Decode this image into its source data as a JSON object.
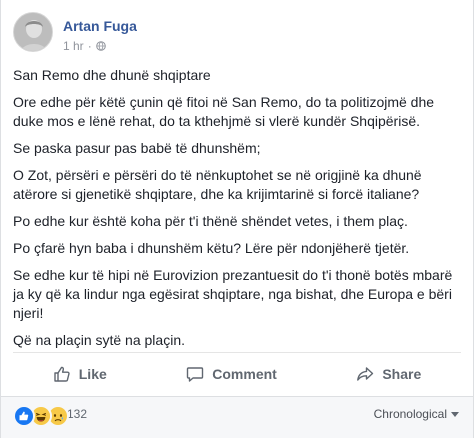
{
  "post": {
    "author": "Artan Fuga",
    "time": "1 hr",
    "separator": "·",
    "paragraphs": [
      "San Remo dhe dhunë shqiptare",
      "Ore edhe për këtë çunin që fitoi në San Remo, do ta politizojmë dhe duke mos e lënë rehat, do ta kthehjmë si vlerë kundër Shqipërisë.",
      "Se paska pasur pas babë të dhunshëm;",
      "O Zot, përsëri e përsëri do të nënkuptohet se në origjinë ka dhunë atërore si gjenetikë shqiptare, dhe ka krijimtarinë si forcë italiane?",
      "Po edhe kur është koha për t'i thënë shëndet vetes, i them plaç.",
      "Po çfarë hyn baba i dhunshëm këtu? Lëre për ndonjëherë tjetër.",
      "Se edhe kur të hipi në Eurovizion prezantuesit do t'i thonë botës mbarë ja ky që ka lindur nga egësirat shqiptare, nga bishat, dhe Europa e bëri njeri!",
      "Që na plaçin sytë na plaçin."
    ]
  },
  "actions": {
    "like": "Like",
    "comment": "Comment",
    "share": "Share"
  },
  "footer": {
    "reaction_count": "132",
    "sort_label": "Chronological",
    "reactions": [
      "like",
      "haha",
      "sad"
    ]
  },
  "colors": {
    "author": "#365899",
    "like_blue": "#1877f2",
    "emoji_yellow": "#f7c948"
  }
}
